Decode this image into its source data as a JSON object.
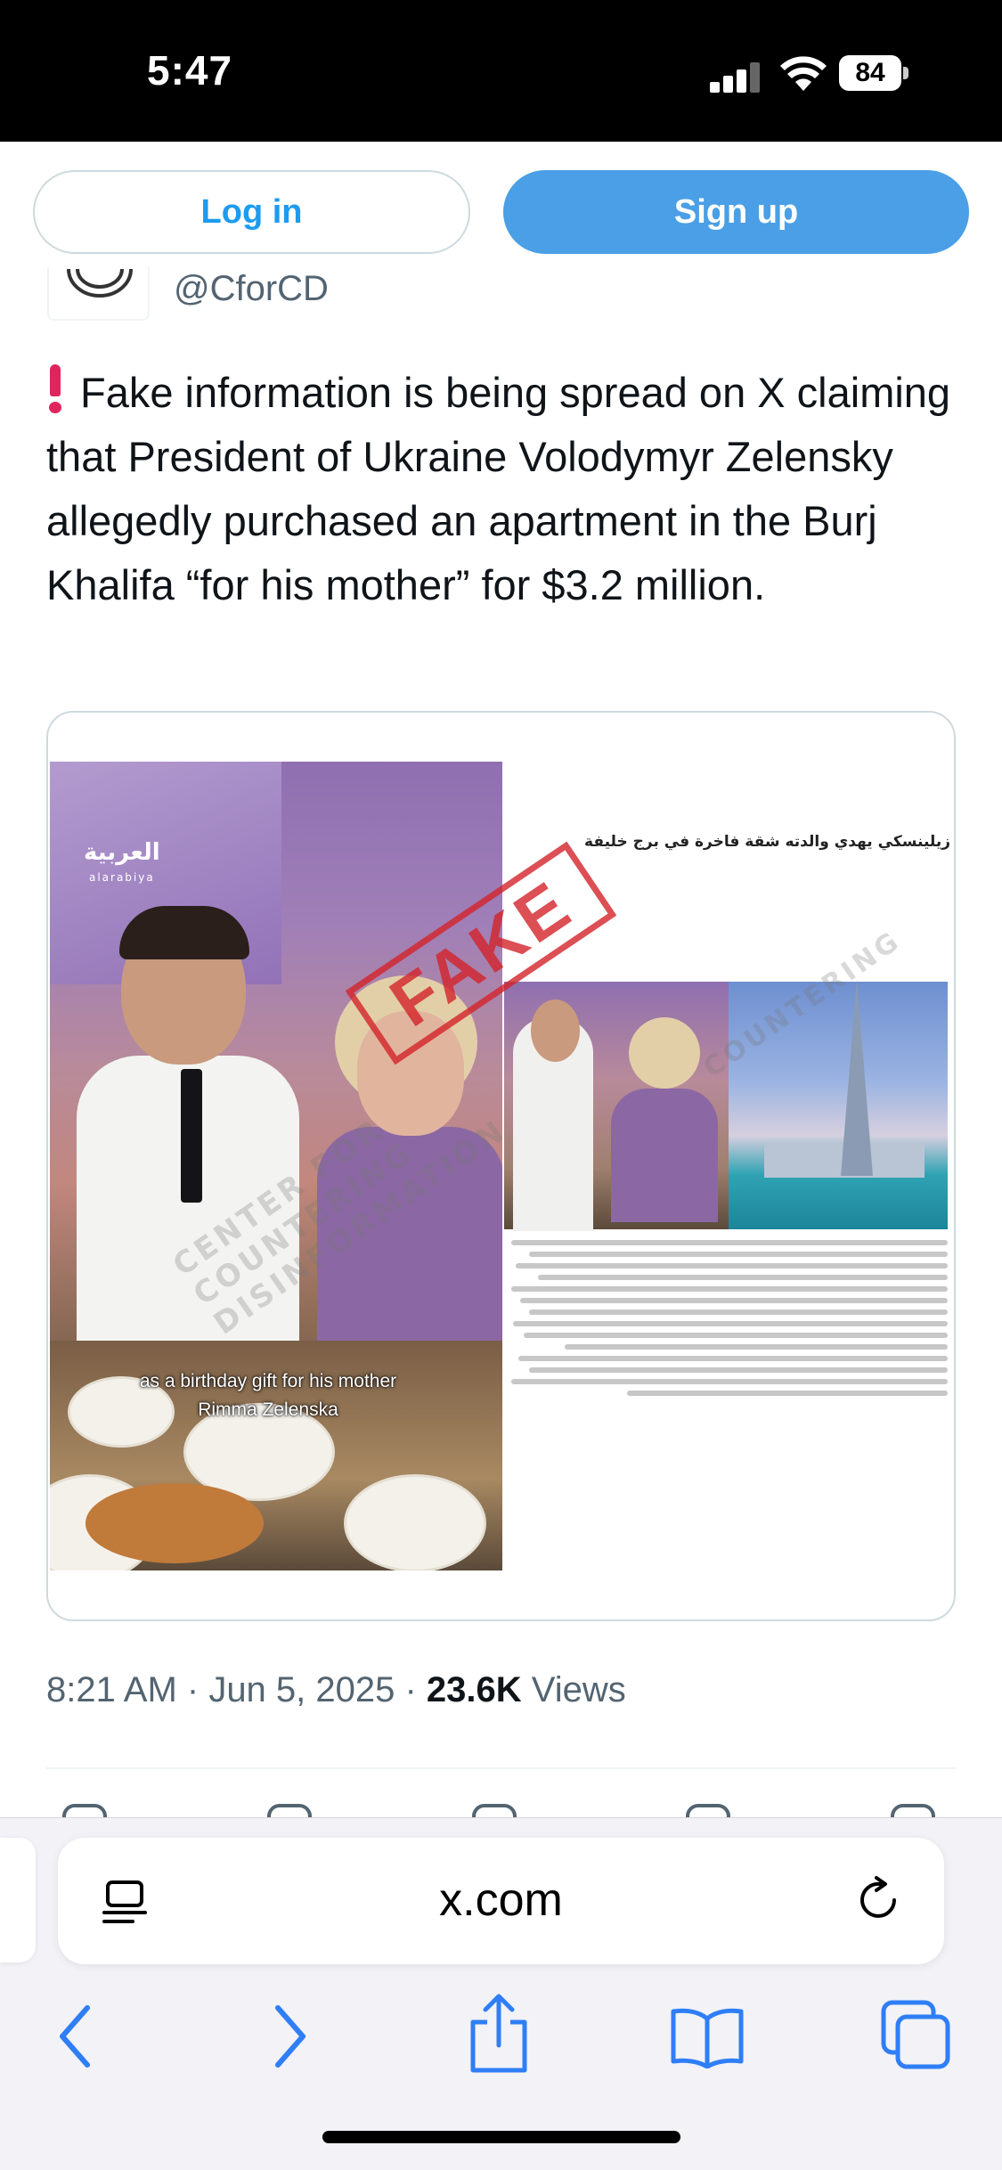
{
  "status_bar": {
    "time": "5:47",
    "battery": "84"
  },
  "auth": {
    "login_label": "Log in",
    "signup_label": "Sign up"
  },
  "author": {
    "handle": "@CforCD"
  },
  "tweet": {
    "text": "Fake information is being spread on X claiming that President of Ukraine Volodymyr Zelensky allegedly purchased an apartment in the Burj Khalifa “for his mother” for $3.2 million.",
    "time": "8:21 AM",
    "sep1": " · ",
    "date": "Jun 5, 2025",
    "sep2": " · ",
    "views_count": "23.6K",
    "views_label": " Views"
  },
  "media": {
    "logo_arabic": "العربية",
    "logo_latin": "alarabiya",
    "caption_line1": "as a birthday gift for his mother",
    "caption_line2": "Rimma Zelenska",
    "stamp": "FAKE",
    "article_title": "زيلينسكي يهدي والدته شقة فاخرة في برج خليفة",
    "article_watermark": "COUNTERING",
    "left_watermark": "CENTER FOR COUNTERING DISINFORMATION"
  },
  "browser": {
    "url": "x.com"
  },
  "colors": {
    "accent": "#1d9bf0",
    "signup_bg": "#4a9fe6",
    "alert": "#e0245e",
    "stamp": "#d4242a"
  },
  "icons": [
    "reader-icon",
    "reload-icon",
    "back-icon",
    "forward-icon",
    "share-icon",
    "bookmarks-icon",
    "tabs-icon",
    "alert-icon",
    "signal-icon",
    "wifi-icon",
    "battery-icon"
  ]
}
